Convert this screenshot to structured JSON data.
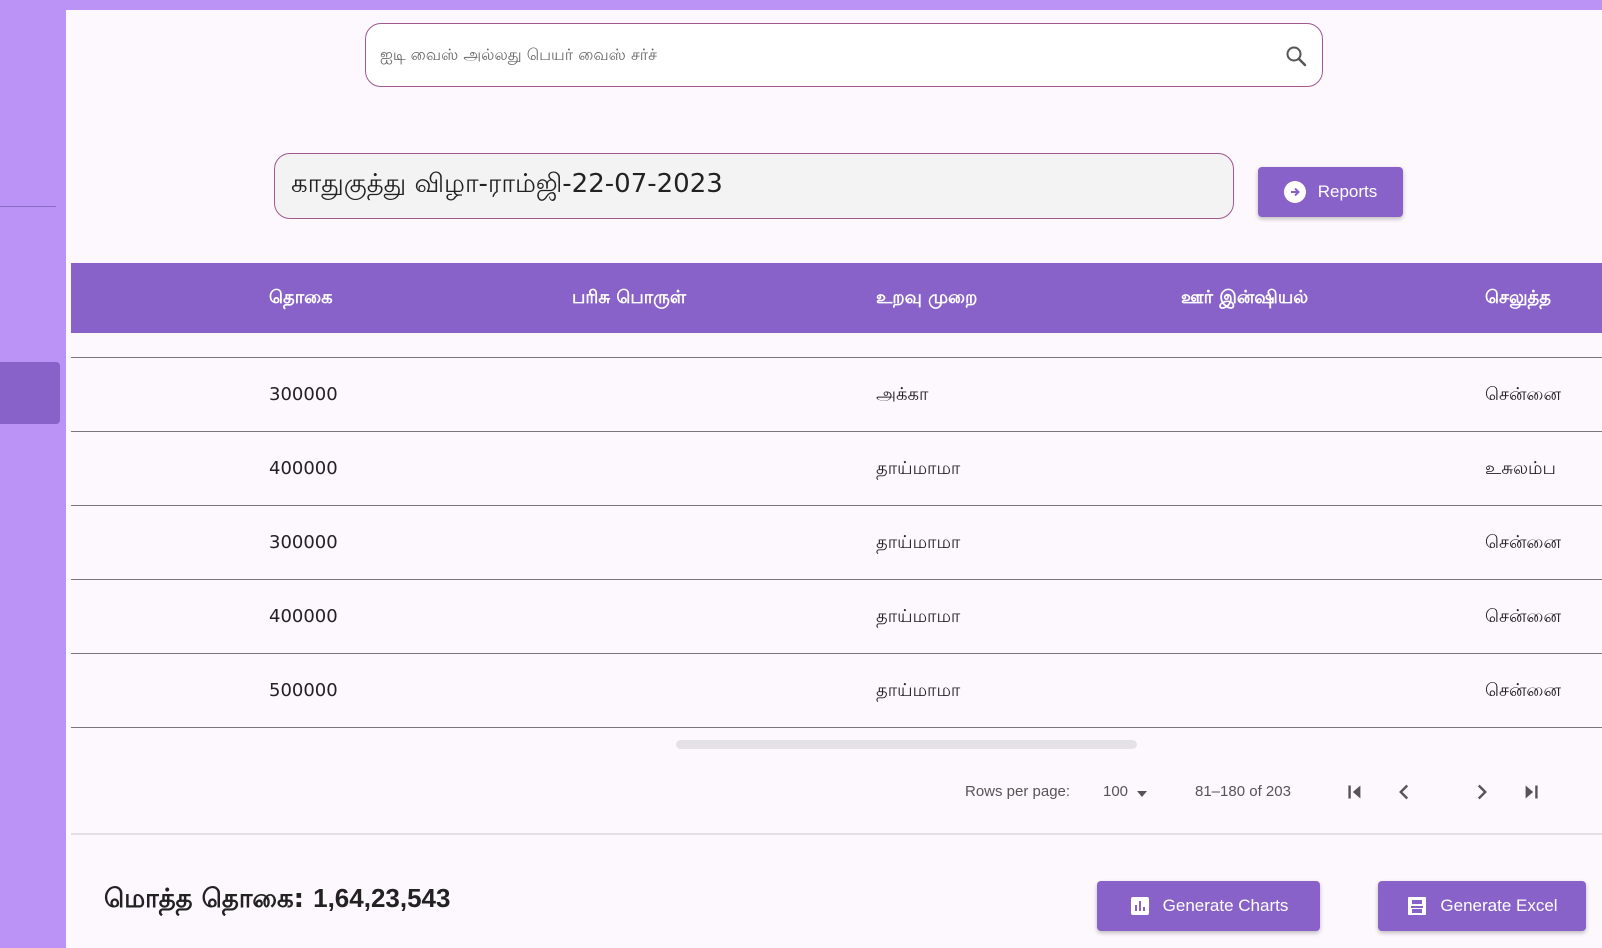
{
  "search": {
    "placeholder": "ஐடி வைஸ் அல்லது பெயர் வைஸ் சர்ச்"
  },
  "event": {
    "title": "காதுகுத்து விழா-ராம்ஜி-22-07-2023"
  },
  "reports": {
    "label": "Reports"
  },
  "table": {
    "columns": [
      "தொகை",
      "பரிசு பொருள்",
      "உறவு முறை",
      "ஊர் இன்ஷியல்",
      "செலுத்த"
    ],
    "rows": [
      {
        "amount": "300000",
        "gift": "",
        "relation": "அக்கா",
        "initial": "",
        "place": "சென்னை"
      },
      {
        "amount": "400000",
        "gift": "",
        "relation": "தாய்மாமா",
        "initial": "",
        "place": "உசுலம்ப"
      },
      {
        "amount": "300000",
        "gift": "",
        "relation": "தாய்மாமா",
        "initial": "",
        "place": "சென்னை"
      },
      {
        "amount": "400000",
        "gift": "",
        "relation": "தாய்மாமா",
        "initial": "",
        "place": "சென்னை"
      },
      {
        "amount": "500000",
        "gift": "",
        "relation": "தாய்மாமா",
        "initial": "",
        "place": "சென்னை"
      }
    ]
  },
  "pagination": {
    "rows_per_page_label": "Rows per page:",
    "rows_per_page_value": "100",
    "range": "81–180 of 203"
  },
  "total": {
    "label": "மொத்த தொகை:",
    "value": "1,64,23,543"
  },
  "buttons": {
    "charts": "Generate Charts",
    "excel": "Generate Excel"
  },
  "colors": {
    "accent": "#8862c8",
    "sidebar": "#bb93f7",
    "background": "#fdf8fd"
  }
}
